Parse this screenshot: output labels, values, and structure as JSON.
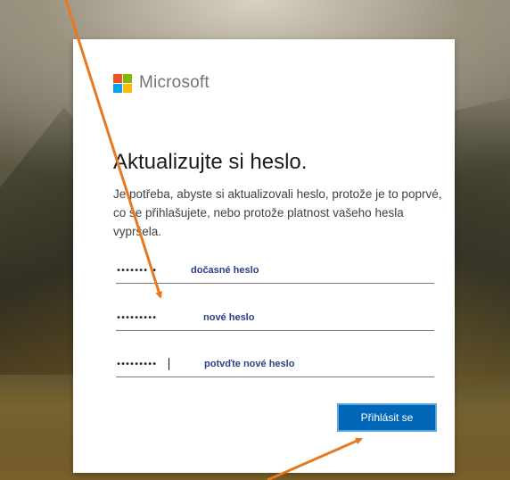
{
  "colors": {
    "accent": "#0067b8",
    "hint_text": "#2c3e8c",
    "arrow": "#e8791e",
    "ms_red": "#f25022",
    "ms_green": "#7fba00",
    "ms_blue": "#00a4ef",
    "ms_yellow": "#ffb900"
  },
  "logo": {
    "icon": "microsoft-logo-icon",
    "text": "Microsoft"
  },
  "title": "Aktualizujte si heslo.",
  "description": "Je potřeba, abyste si aktualizovali heslo, protože je to poprvé, co se přihlašujete, nebo protože platnost vašeho hesla vypršela.",
  "fields": [
    {
      "masked": "••••••• •",
      "annotation": "dočasné heslo"
    },
    {
      "masked": "•••••••••",
      "annotation": "nové heslo"
    },
    {
      "masked": "•••••••••",
      "annotation": "potvďte nové heslo"
    }
  ],
  "signin_button": "Přihlásit se"
}
